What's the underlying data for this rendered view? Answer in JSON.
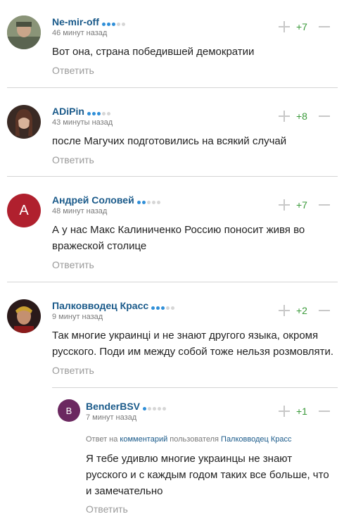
{
  "comments": [
    {
      "author": "Ne-mir-off",
      "rating_dots": [
        1,
        1,
        1,
        0,
        0
      ],
      "time": "46 минут назад",
      "text": "Вот она, страна победившей демократии",
      "score": "+7",
      "reply_label": "Ответить",
      "avatar_icon": "user-photo"
    },
    {
      "author": "ADiPin",
      "rating_dots": [
        1,
        1,
        1,
        0,
        0
      ],
      "time": "43 минуты назад",
      "text": "после Магучих подготовились на всякий случай",
      "score": "+8",
      "reply_label": "Ответить",
      "avatar_icon": "user-photo"
    },
    {
      "author": "Андрей Соловей",
      "avatar_letter": "A",
      "rating_dots": [
        1,
        1,
        0,
        0,
        0
      ],
      "time": "48 минут назад",
      "text_line1": "А у нас Макс Калиниченко Россию поносит живя во",
      "text_line2": "вражеской столице",
      "score": "+7",
      "reply_label": "Ответить"
    },
    {
      "author": "Палковводец Красс",
      "rating_dots": [
        1,
        1,
        1,
        0,
        0
      ],
      "time": "9 минут назад",
      "text_line1": "Так многие украинці и не знают другого языка, окромя",
      "text_line2": "русского. Поди им между собой тоже нельзя розмовляти.",
      "score": "+2",
      "reply_label": "Ответить",
      "avatar_icon": "user-photo"
    }
  ],
  "nested_reply": {
    "author": "BenderBSV",
    "avatar_letter": "B",
    "rating_dots": [
      1,
      0,
      0,
      0,
      0
    ],
    "time": "7 минут назад",
    "meta_prefix": "Ответ на",
    "meta_link": "комментарий",
    "meta_middle": "пользователя",
    "meta_user": "Палковводец Красс",
    "text_line1": "Я тебе удивлю многие украинцы не знают",
    "text_line2": "русского и с каждым годом таких все больше, что",
    "text_line3": "и замечательно",
    "score": "+1",
    "reply_label": "Ответить"
  },
  "colors": {
    "author": "#1a5a8a",
    "score": "#3a9a3a",
    "reply": "#9a9a9a",
    "rating_on": "#2f8fd8",
    "rating_off": "#d6d6d6",
    "avatar_red": "#b0202e",
    "avatar_purple": "#6b2860"
  }
}
